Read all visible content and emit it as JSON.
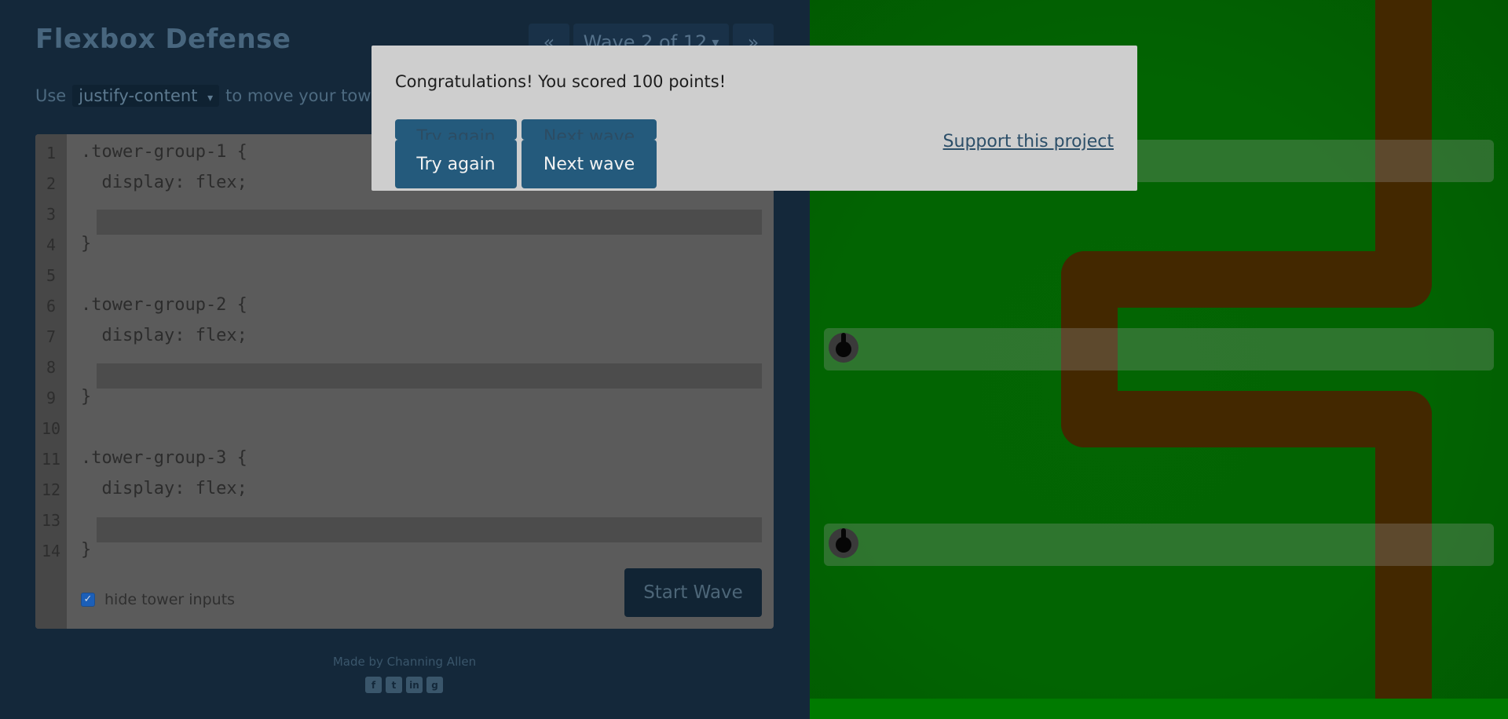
{
  "header": {
    "title": "Flexbox Defense",
    "prev_label": "«",
    "wave_label": "Wave 2 of 12",
    "wave_caret": "▾",
    "next_label": "»"
  },
  "instruction": {
    "prefix": "Use",
    "property": "justify-content",
    "property_caret": "▾",
    "suffix": "to move your towe"
  },
  "editor": {
    "line_numbers": [
      "1",
      "2",
      "3",
      "4",
      "5",
      "6",
      "7",
      "8",
      "9",
      "10",
      "11",
      "12",
      "13",
      "14"
    ],
    "lines": [
      ".tower-group-1 {",
      "  display: flex;",
      "",
      "}",
      "",
      ".tower-group-2 {",
      "  display: flex;",
      "",
      "}",
      "",
      ".tower-group-3 {",
      "  display: flex;",
      "",
      "}"
    ],
    "hide_inputs_label": "hide tower inputs",
    "hide_inputs_checked": true,
    "start_label": "Start Wave"
  },
  "footer": {
    "made_by": "Made by Channing Allen",
    "icons": [
      "facebook-icon",
      "twitter-icon",
      "linkedin-icon",
      "github-icon"
    ]
  },
  "modal": {
    "message": "Congratulations! You scored 100 points!",
    "try_again_label": "Try again",
    "next_wave_label": "Next wave",
    "try_again_ghost": "Try again",
    "next_wave_ghost": "Next wave",
    "support_label": "Support this project"
  },
  "colors": {
    "grass": "#026402",
    "path": "#432800",
    "modal_bg": "#cecece",
    "modal_button": "#245a7c",
    "panel_bg": "#14283a"
  }
}
